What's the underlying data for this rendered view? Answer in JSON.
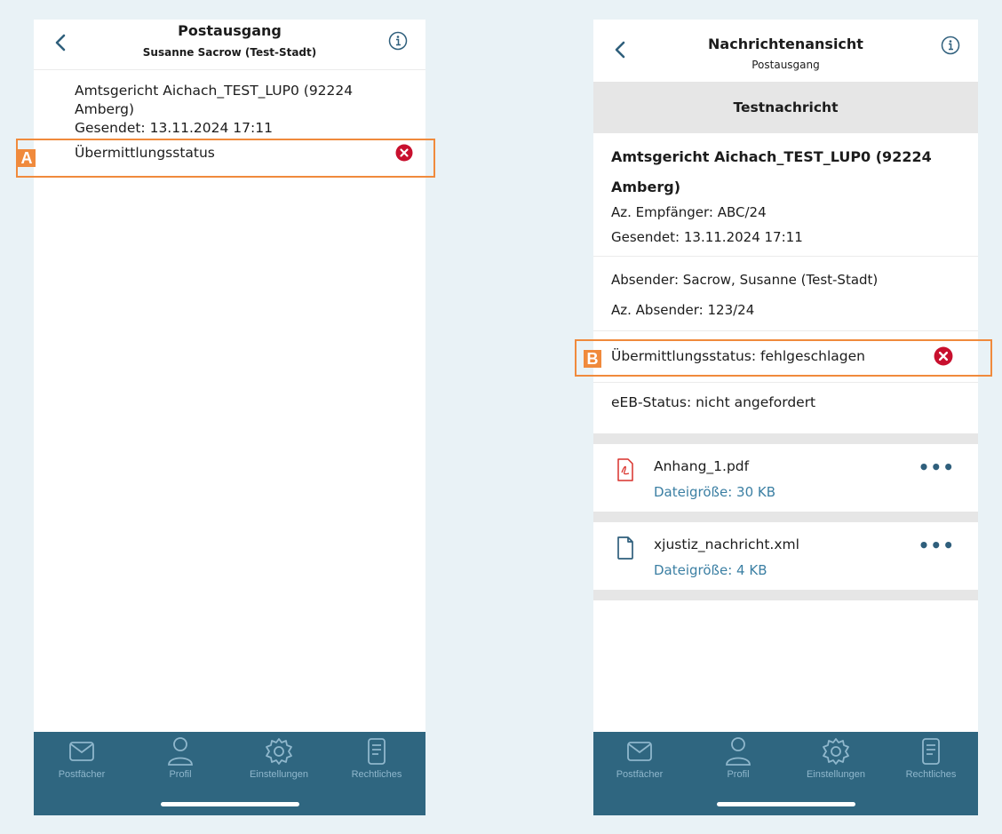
{
  "left_screen": {
    "header": {
      "title": "Postausgang",
      "subtitle": "Susanne Sacrow (Test-Stadt)"
    },
    "message": {
      "recipient_line1": "Amtsgericht Aichach_TEST_LUP0 (92224",
      "recipient_line2": "Amberg)",
      "sent": "Gesendet: 13.11.2024 17:11",
      "status_label": "Übermittlungsstatus"
    },
    "highlight_tag": "A"
  },
  "right_screen": {
    "header": {
      "title": "Nachrichtenansicht",
      "subtitle": "Postausgang"
    },
    "subject": "Testnachricht",
    "recipient_line1": "Amtsgericht Aichach_TEST_LUP0 (92224",
    "recipient_line2": "Amberg)",
    "az_empfaenger": "Az. Empfänger: ABC/24",
    "sent": "Gesendet: 13.11.2024 17:11",
    "absender": "Absender: Sacrow, Susanne (Test-Stadt)",
    "az_absender": "Az. Absender: 123/24",
    "status": "Übermittlungsstatus: fehlgeschlagen",
    "eeb_status": "eEB-Status: nicht angefordert",
    "attachments": [
      {
        "name": "Anhang_1.pdf",
        "size": "Dateigröße: 30 KB",
        "icon": "pdf-file-icon"
      },
      {
        "name": "xjustiz_nachricht.xml",
        "size": "Dateigröße: 4 KB",
        "icon": "file-icon"
      }
    ],
    "more_label": "•••",
    "highlight_tag": "B"
  },
  "tabbar": {
    "items": [
      {
        "label": "Postfächer",
        "icon": "mail-icon"
      },
      {
        "label": "Profil",
        "icon": "person-icon"
      },
      {
        "label": "Einstellungen",
        "icon": "gear-icon"
      },
      {
        "label": "Rechtliches",
        "icon": "document-icon"
      }
    ]
  },
  "colors": {
    "background": "#e9f2f6",
    "tabbar": "#2f6680",
    "tab_label": "#8fb7cc",
    "highlight": "#f08a3c",
    "error": "#c8102e",
    "accent_blue": "#3b7fa3"
  }
}
